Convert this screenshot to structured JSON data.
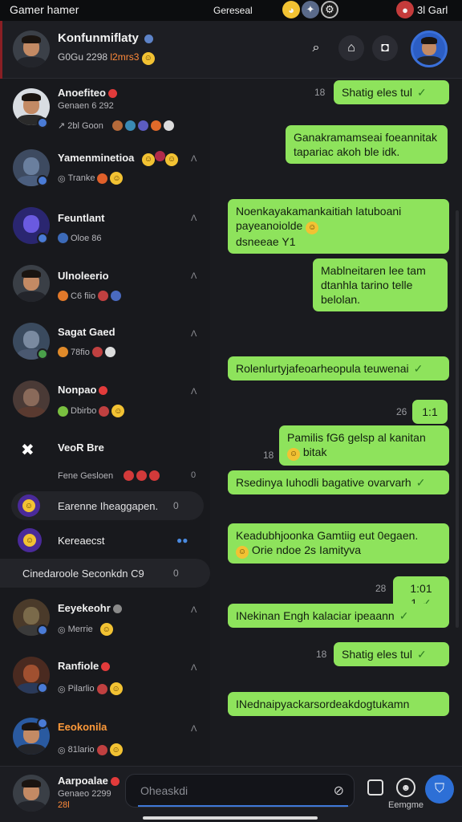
{
  "status_bar": {
    "left": "Gamer hamer",
    "middle": "Gereseal",
    "right": "3l Garl"
  },
  "header": {
    "name": "Konfunmiflaty",
    "sub_prefix": "G0Gu 2298",
    "sub_highlight": "l2mrs3"
  },
  "conversations": [
    {
      "name": "Anoefiteo",
      "line1": "Genaen 6 292",
      "line2": "2bl Goon",
      "badge": "red"
    },
    {
      "name": "Yamenminetioa",
      "line1": "Tranke",
      "meta": "Ʌ"
    },
    {
      "name": "Feuntlant",
      "line1": "Oloe 86",
      "meta": "Ʌ"
    },
    {
      "name": "Ulnoleerio",
      "line1": "C6 fiio",
      "meta": "Ʌ"
    },
    {
      "name": "Sagat Gaed",
      "line1": "78fio",
      "meta": "Ʌ"
    },
    {
      "name": "Nonpao",
      "line1": "Dbirbo",
      "meta": "Ʌ",
      "badge": "red"
    },
    {
      "name": "VeoR Bre",
      "line1": "Fene Gesloen",
      "meta": "0"
    },
    {
      "name": "Earenne Iheaggapen.",
      "meta": "0",
      "pill": true
    },
    {
      "name": "Kereaecst",
      "pill": false
    },
    {
      "name": "Cinedaroole Seconkdn C9",
      "meta": "0",
      "pill": true
    },
    {
      "name": "Eeyekeohr",
      "line1": "Merrie",
      "meta": "Ʌ"
    },
    {
      "name": "Ranfiole",
      "line1": "Pilarlio",
      "meta": "Ʌ",
      "badge": "red"
    },
    {
      "name": "Eeokonila",
      "line1": "81lario",
      "meta": "Ʌ"
    }
  ],
  "messages": [
    {
      "text": "Shatig eles tul",
      "time": "18"
    },
    {
      "text": "Ganakramamseai foeannitak tapariac akoh ble idk.",
      "time": ""
    },
    {
      "text": "Noenkayakamankaitiah latuboani payeanoiolde",
      "text2": "dsneeae Y1",
      "time": ""
    },
    {
      "text": "Mablneitaren lee tam dtanhla tarino telle belolan.",
      "time": ""
    },
    {
      "text": "Rolenlurtyjafeoarheopula teuwenai",
      "time": ""
    },
    {
      "text": "1:1",
      "time": "26"
    },
    {
      "text": "Pamilis fG6 gelsp al kanitan",
      "text2": "bitak",
      "time": "18"
    },
    {
      "text": "Rsedinya Iuhodli bagative ovarvarh",
      "time": ""
    },
    {
      "text": "Keadubhjoonka Gamtiig eut 0egaen.",
      "text2": "Orie ndoe 2s Iamityva",
      "time": ""
    },
    {
      "text": "1:01 1",
      "time": "28"
    },
    {
      "text": "INekinan Engh kalaciar ipeaann",
      "time": ""
    },
    {
      "text": "Shatig eles tul",
      "time": "18"
    },
    {
      "text": "INednaipyackarsordeakdogtukamn",
      "time": ""
    }
  ],
  "bottom": {
    "name": "Aarpoalae",
    "line1": "Genaeo 2299",
    "line2": "28l",
    "input_placeholder": "Oheaskdi",
    "right_label": "Eemgme"
  }
}
